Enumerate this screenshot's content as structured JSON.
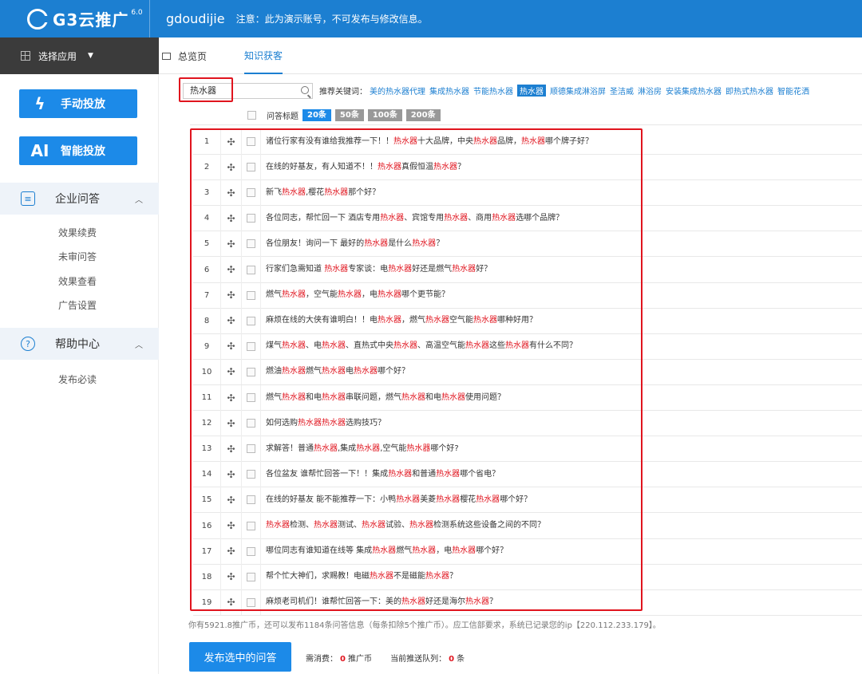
{
  "header": {
    "logo_text": "G3云推广",
    "logo_version": "6.0",
    "username": "gdoudijie",
    "notice": "注意：此为演示账号，不可发布与修改信息。"
  },
  "nav": {
    "app_select": "选择应用",
    "tabs": [
      {
        "label": "总览页"
      },
      {
        "label": "知识获客"
      }
    ]
  },
  "sidebar": {
    "manual_btn": "手动投放",
    "ai_icon": "AI",
    "ai_btn": "智能投放",
    "section1": {
      "label": "企业问答",
      "items": [
        "效果续费",
        "未审问答",
        "效果查看",
        "广告设置"
      ]
    },
    "section2": {
      "label": "帮助中心",
      "items": [
        "发布必读"
      ]
    }
  },
  "search": {
    "value": "热水器",
    "kw_label": "推荐关键词：",
    "keywords": [
      "美的热水器代理",
      "集成热水器",
      "节能热水器",
      "热水器",
      "顺德集成淋浴屏",
      "圣洁威",
      "淋浴房",
      "安装集成热水器",
      "即热式热水器",
      "智能花洒"
    ],
    "active_keyword_index": 3
  },
  "table": {
    "header_label": "问答标题",
    "page_sizes": [
      "20条",
      "50条",
      "100条",
      "200条"
    ],
    "active_page_size_index": 0,
    "rows": [
      {
        "no": "1",
        "segs": [
          [
            "诸位行家有没有谁给我推荐一下！！",
            0
          ],
          [
            "热水器",
            1
          ],
          [
            "十大品牌，中央",
            0
          ],
          [
            "热水器",
            1
          ],
          [
            "品牌，",
            0
          ],
          [
            "热水器",
            1
          ],
          [
            "哪个牌子好？",
            0
          ]
        ]
      },
      {
        "no": "2",
        "segs": [
          [
            "在线的好基友，有人知道不！！",
            0
          ],
          [
            "热水器",
            1
          ],
          [
            "真假恒温",
            0
          ],
          [
            "热水器",
            1
          ],
          [
            "？",
            0
          ]
        ]
      },
      {
        "no": "3",
        "segs": [
          [
            "新飞",
            0
          ],
          [
            "热水器",
            1
          ],
          [
            ",樱花",
            0
          ],
          [
            "热水器",
            1
          ],
          [
            "那个好？",
            0
          ]
        ]
      },
      {
        "no": "4",
        "segs": [
          [
            "各位同志，帮忙回一下 酒店专用",
            0
          ],
          [
            "热水器",
            1
          ],
          [
            "、宾馆专用",
            0
          ],
          [
            "热水器",
            1
          ],
          [
            "、商用",
            0
          ],
          [
            "热水器",
            1
          ],
          [
            "选哪个品牌？",
            0
          ]
        ]
      },
      {
        "no": "5",
        "segs": [
          [
            "各位朋友！询问一下 最好的",
            0
          ],
          [
            "热水器",
            1
          ],
          [
            "是什么",
            0
          ],
          [
            "热水器",
            1
          ],
          [
            "？",
            0
          ]
        ]
      },
      {
        "no": "6",
        "segs": [
          [
            "行家们急需知道 ",
            0
          ],
          [
            "热水器",
            1
          ],
          [
            "专家谈：电",
            0
          ],
          [
            "热水器",
            1
          ],
          [
            "好还是燃气",
            0
          ],
          [
            "热水器",
            1
          ],
          [
            "好？",
            0
          ]
        ]
      },
      {
        "no": "7",
        "segs": [
          [
            "燃气",
            0
          ],
          [
            "热水器",
            1
          ],
          [
            "，空气能",
            0
          ],
          [
            "热水器",
            1
          ],
          [
            "，电",
            0
          ],
          [
            "热水器",
            1
          ],
          [
            "哪个更节能？",
            0
          ]
        ]
      },
      {
        "no": "8",
        "segs": [
          [
            "麻烦在线的大侠有谁明白！！电",
            0
          ],
          [
            "热水器",
            1
          ],
          [
            "，燃气",
            0
          ],
          [
            "热水器",
            1
          ],
          [
            "空气能",
            0
          ],
          [
            "热水器",
            1
          ],
          [
            "哪种好用？",
            0
          ]
        ]
      },
      {
        "no": "9",
        "segs": [
          [
            "煤气",
            0
          ],
          [
            "热水器",
            1
          ],
          [
            "、电",
            0
          ],
          [
            "热水器",
            1
          ],
          [
            "、直热式中央",
            0
          ],
          [
            "热水器",
            1
          ],
          [
            "、高温空气能",
            0
          ],
          [
            "热水器",
            1
          ],
          [
            "这些",
            0
          ],
          [
            "热水器",
            1
          ],
          [
            "有什么不同？",
            0
          ]
        ]
      },
      {
        "no": "10",
        "segs": [
          [
            "燃油",
            0
          ],
          [
            "热水器",
            1
          ],
          [
            "燃气",
            0
          ],
          [
            "热水器",
            1
          ],
          [
            "电",
            0
          ],
          [
            "热水器",
            1
          ],
          [
            "哪个好？",
            0
          ]
        ]
      },
      {
        "no": "11",
        "segs": [
          [
            "燃气",
            0
          ],
          [
            "热水器",
            1
          ],
          [
            "和电",
            0
          ],
          [
            "热水器",
            1
          ],
          [
            "串联问题，燃气",
            0
          ],
          [
            "热水器",
            1
          ],
          [
            "和电",
            0
          ],
          [
            "热水器",
            1
          ],
          [
            "使用问题？",
            0
          ]
        ]
      },
      {
        "no": "12",
        "segs": [
          [
            "如何选购",
            0
          ],
          [
            "热水器",
            1
          ],
          [
            "热水器",
            1
          ],
          [
            "选购技巧？",
            0
          ]
        ]
      },
      {
        "no": "13",
        "segs": [
          [
            "求解答！普通",
            0
          ],
          [
            "热水器",
            1
          ],
          [
            ",集成",
            0
          ],
          [
            "热水器",
            1
          ],
          [
            ",空气能",
            0
          ],
          [
            "热水器",
            1
          ],
          [
            "哪个好?",
            0
          ]
        ]
      },
      {
        "no": "14",
        "segs": [
          [
            "各位盆友 谁帮忙回答一下！！集成",
            0
          ],
          [
            "热水器",
            1
          ],
          [
            "和普通",
            0
          ],
          [
            "热水器",
            1
          ],
          [
            "哪个省电？",
            0
          ]
        ]
      },
      {
        "no": "15",
        "segs": [
          [
            "在线的好基友 能不能推荐一下：小鸭",
            0
          ],
          [
            "热水器",
            1
          ],
          [
            "美菱",
            0
          ],
          [
            "热水器",
            1
          ],
          [
            "樱花",
            0
          ],
          [
            "热水器",
            1
          ],
          [
            "哪个好？",
            0
          ]
        ]
      },
      {
        "no": "16",
        "segs": [
          [
            "热水器",
            1
          ],
          [
            "检测、",
            0
          ],
          [
            "热水器",
            1
          ],
          [
            "测试、",
            0
          ],
          [
            "热水器",
            1
          ],
          [
            "试验、",
            0
          ],
          [
            "热水器",
            1
          ],
          [
            "检测系统这些设备之间的不同？",
            0
          ]
        ]
      },
      {
        "no": "17",
        "segs": [
          [
            "哪位同志有谁知道在线等 集成",
            0
          ],
          [
            "热水器",
            1
          ],
          [
            "燃气",
            0
          ],
          [
            "热水器",
            1
          ],
          [
            "，电",
            0
          ],
          [
            "热水器",
            1
          ],
          [
            "哪个好？",
            0
          ]
        ]
      },
      {
        "no": "18",
        "segs": [
          [
            "帮个忙大神们，求赐教！电磁",
            0
          ],
          [
            "热水器",
            1
          ],
          [
            "不是磁能",
            0
          ],
          [
            "热水器",
            1
          ],
          [
            "？",
            0
          ]
        ]
      },
      {
        "no": "19",
        "segs": [
          [
            "麻烦老司机们！谁帮忙回答一下：美的",
            0
          ],
          [
            "热水器",
            1
          ],
          [
            "好还是海尔",
            0
          ],
          [
            "热水器",
            1
          ],
          [
            "？",
            0
          ]
        ]
      }
    ]
  },
  "footer": {
    "note": "你有5921.8推广币，还可以发布1184条问答信息（每条扣除5个推广币）。应工信部要求，系统已记录您的ip【220.112.233.179】。",
    "publish_btn": "发布选中的问答",
    "cost_label": "需消费：",
    "cost_value": "0",
    "cost_unit": "推广币",
    "queue_label": "当前推送队列：",
    "queue_value": "0",
    "queue_unit": "条"
  },
  "colors": {
    "brand": "#1c7fd1",
    "highlight": "#e0141e"
  }
}
